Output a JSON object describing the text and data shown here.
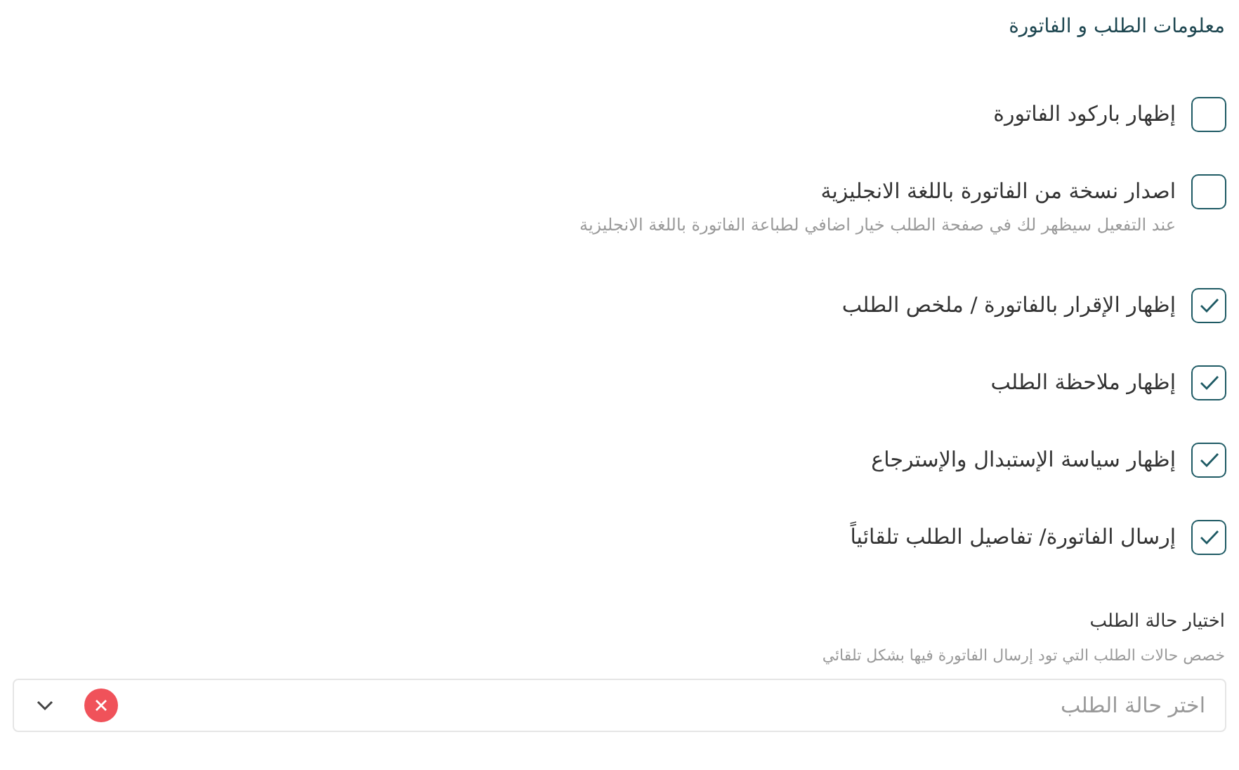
{
  "section": {
    "title": "معلومات الطلب و الفاتورة"
  },
  "options": [
    {
      "label": "إظهار باركود الفاتورة",
      "checked": false
    },
    {
      "label": "اصدار نسخة من الفاتورة باللغة الانجليزية",
      "checked": false,
      "hint": "عند التفعيل سيظهر لك في صفحة الطلب خيار اضافي لطباعة الفاتورة باللغة الانجليزية"
    },
    {
      "label": "إظهار الإقرار بالفاتورة / ملخص الطلب",
      "checked": true
    },
    {
      "label": "إظهار ملاحظة الطلب",
      "checked": true
    },
    {
      "label": "إظهار سياسة الإستبدال والإسترجاع",
      "checked": true
    },
    {
      "label": "إرسال الفاتورة/ تفاصيل الطلب تلقائياً",
      "checked": true
    }
  ],
  "order_status": {
    "label": "اختيار حالة الطلب",
    "hint": "خصص حالات الطلب التي تود إرسال الفاتورة فيها بشكل تلقائي",
    "placeholder": "اختر حالة الطلب"
  }
}
